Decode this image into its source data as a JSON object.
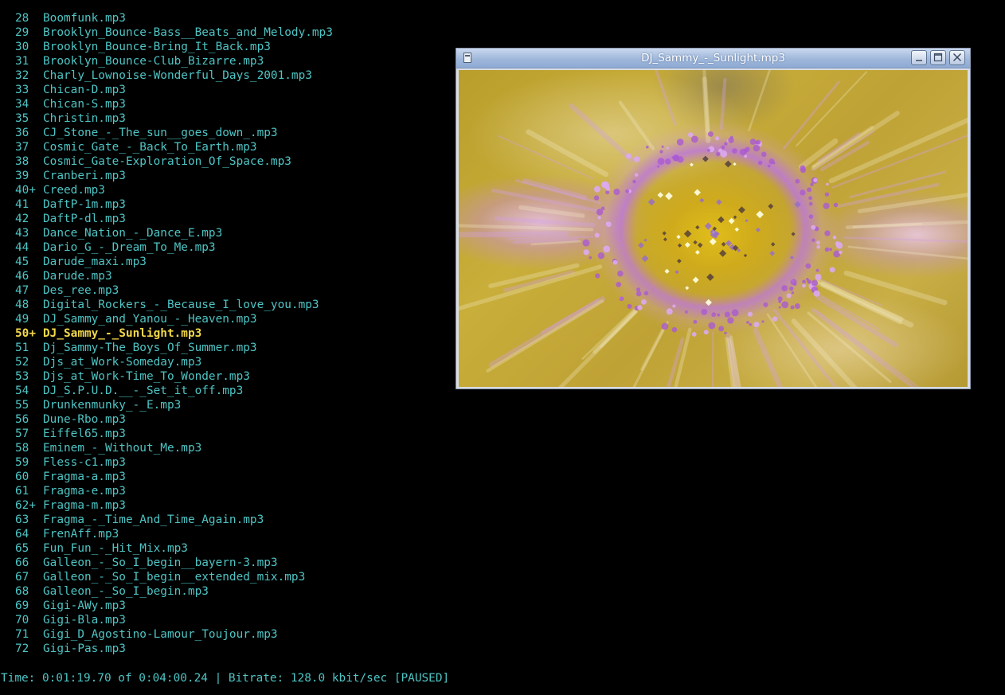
{
  "playlist": {
    "items": [
      {
        "num": "28",
        "name": "Boomfunk.mp3"
      },
      {
        "num": "29",
        "name": "Brooklyn_Bounce-Bass__Beats_and_Melody.mp3"
      },
      {
        "num": "30",
        "name": "Brooklyn_Bounce-Bring_It_Back.mp3"
      },
      {
        "num": "31",
        "name": "Brooklyn_Bounce-Club_Bizarre.mp3"
      },
      {
        "num": "32",
        "name": "Charly_Lownoise-Wonderful_Days_2001.mp3"
      },
      {
        "num": "33",
        "name": "Chican-D.mp3"
      },
      {
        "num": "34",
        "name": "Chican-S.mp3"
      },
      {
        "num": "35",
        "name": "Christin.mp3"
      },
      {
        "num": "36",
        "name": "CJ_Stone_-_The_sun__goes_down_.mp3"
      },
      {
        "num": "37",
        "name": "Cosmic_Gate_-_Back_To_Earth.mp3"
      },
      {
        "num": "38",
        "name": "Cosmic_Gate-Exploration_Of_Space.mp3"
      },
      {
        "num": "39",
        "name": "Cranberi.mp3"
      },
      {
        "num": "40+",
        "name": "Creed.mp3"
      },
      {
        "num": "41",
        "name": "DaftP-1m.mp3"
      },
      {
        "num": "42",
        "name": "DaftP-dl.mp3"
      },
      {
        "num": "43",
        "name": "Dance_Nation_-_Dance_E.mp3"
      },
      {
        "num": "44",
        "name": "Dario_G_-_Dream_To_Me.mp3"
      },
      {
        "num": "45",
        "name": "Darude_maxi.mp3"
      },
      {
        "num": "46",
        "name": "Darude.mp3"
      },
      {
        "num": "47",
        "name": "Des_ree.mp3"
      },
      {
        "num": "48",
        "name": "Digital_Rockers_-_Because_I_love_you.mp3"
      },
      {
        "num": "49",
        "name": "DJ_Sammy_and_Yanou_-_Heaven.mp3"
      },
      {
        "num": "50+",
        "name": "DJ_Sammy_-_Sunlight.mp3",
        "current": true
      },
      {
        "num": "51",
        "name": "Dj_Sammy-The_Boys_Of_Summer.mp3"
      },
      {
        "num": "52",
        "name": "Djs_at_Work-Someday.mp3"
      },
      {
        "num": "53",
        "name": "Djs_at_Work-Time_To_Wonder.mp3"
      },
      {
        "num": "54",
        "name": "DJ_S.P.U.D.__-_Set_it_off.mp3"
      },
      {
        "num": "55",
        "name": "Drunkenmunky_-_E.mp3"
      },
      {
        "num": "56",
        "name": "Dune-Rbo.mp3"
      },
      {
        "num": "57",
        "name": "Eiffel65.mp3"
      },
      {
        "num": "58",
        "name": "Eminem_-_Without_Me.mp3"
      },
      {
        "num": "59",
        "name": "Fless-c1.mp3"
      },
      {
        "num": "60",
        "name": "Fragma-a.mp3"
      },
      {
        "num": "61",
        "name": "Fragma-e.mp3"
      },
      {
        "num": "62+",
        "name": "Fragma-m.mp3"
      },
      {
        "num": "63",
        "name": "Fragma_-_Time_And_Time_Again.mp3"
      },
      {
        "num": "64",
        "name": "FrenAff.mp3"
      },
      {
        "num": "65",
        "name": "Fun_Fun_-_Hit_Mix.mp3"
      },
      {
        "num": "66",
        "name": "Galleon_-_So_I_begin__bayern-3.mp3"
      },
      {
        "num": "67",
        "name": "Galleon_-_So_I_begin__extended_mix.mp3"
      },
      {
        "num": "68",
        "name": "Galleon_-_So_I_begin.mp3"
      },
      {
        "num": "69",
        "name": "Gigi-AWy.mp3"
      },
      {
        "num": "70",
        "name": "Gigi-Bla.mp3"
      },
      {
        "num": "71",
        "name": "Gigi_D_Agostino-Lamour_Toujour.mp3"
      },
      {
        "num": "72",
        "name": "Gigi-Pas.mp3"
      }
    ]
  },
  "status": {
    "text": "Time: 0:01:19.70 of 0:04:00.24 | Bitrate: 128.0 kbit/sec [PAUSED]"
  },
  "viz_window": {
    "title": "DJ_Sammy_-_Sunlight.mp3",
    "buttons": {
      "menu_icon": "window-menu-icon",
      "minimize_icon": "minimize-icon",
      "maximize_icon": "maximize-icon",
      "close_icon": "close-icon"
    }
  },
  "colors": {
    "background": "#000000",
    "text": "#4fc4c4",
    "current_track": "#f2d84a",
    "titlebar": "#9fb7da"
  }
}
